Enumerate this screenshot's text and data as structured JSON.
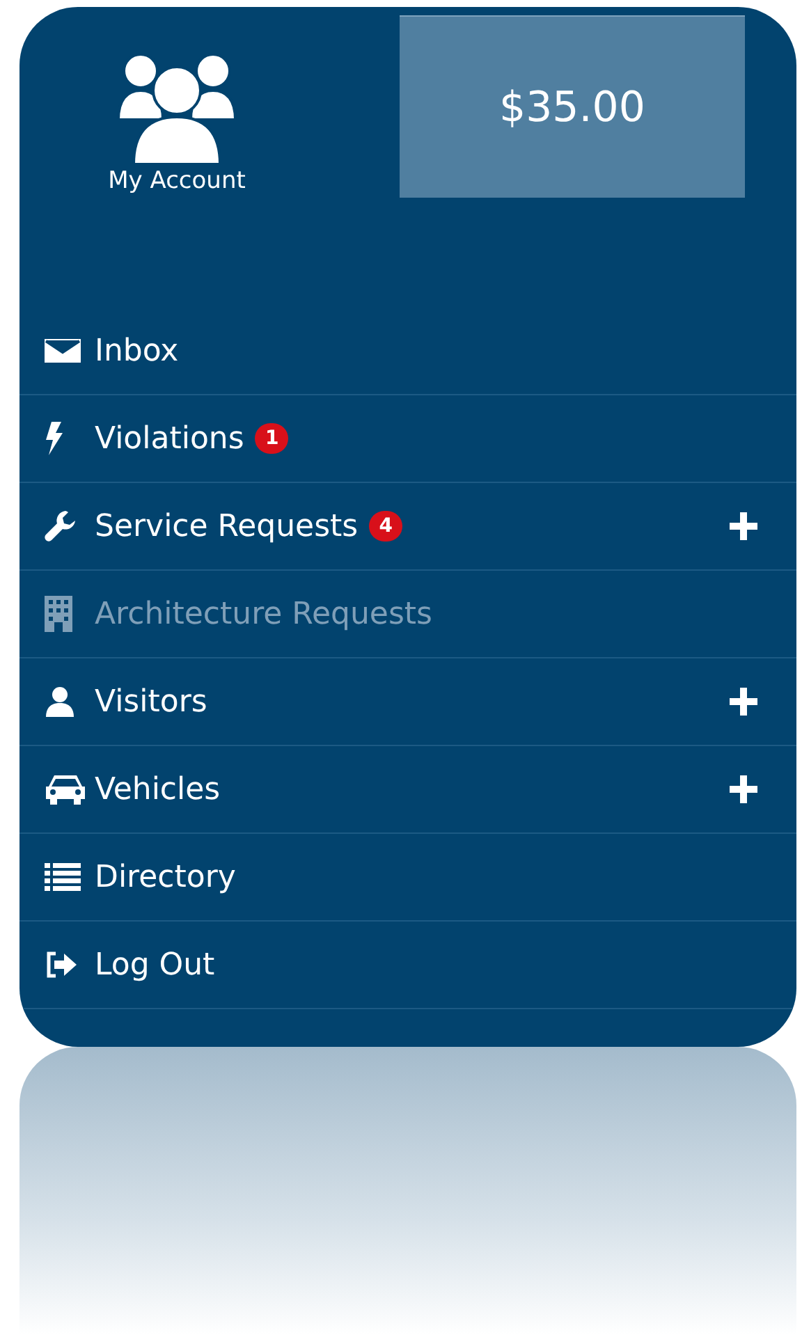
{
  "account": {
    "label": "My Account"
  },
  "balance": "$35.00",
  "menu": [
    {
      "label": "Inbox",
      "kind": "envelope",
      "disabled": false,
      "expandable": false
    },
    {
      "label": "Violations",
      "kind": "bolt",
      "disabled": false,
      "expandable": false,
      "badge": "1"
    },
    {
      "label": "Service Requests",
      "kind": "wrench",
      "disabled": false,
      "expandable": true,
      "badge": "4"
    },
    {
      "label": "Architecture Requests",
      "kind": "building",
      "disabled": true,
      "expandable": false
    },
    {
      "label": "Visitors",
      "kind": "user",
      "disabled": false,
      "expandable": true
    },
    {
      "label": "Vehicles",
      "kind": "car",
      "disabled": false,
      "expandable": true
    },
    {
      "label": "Directory",
      "kind": "list",
      "disabled": false,
      "expandable": false
    },
    {
      "label": "Log Out",
      "kind": "logout",
      "disabled": false,
      "expandable": false
    }
  ]
}
